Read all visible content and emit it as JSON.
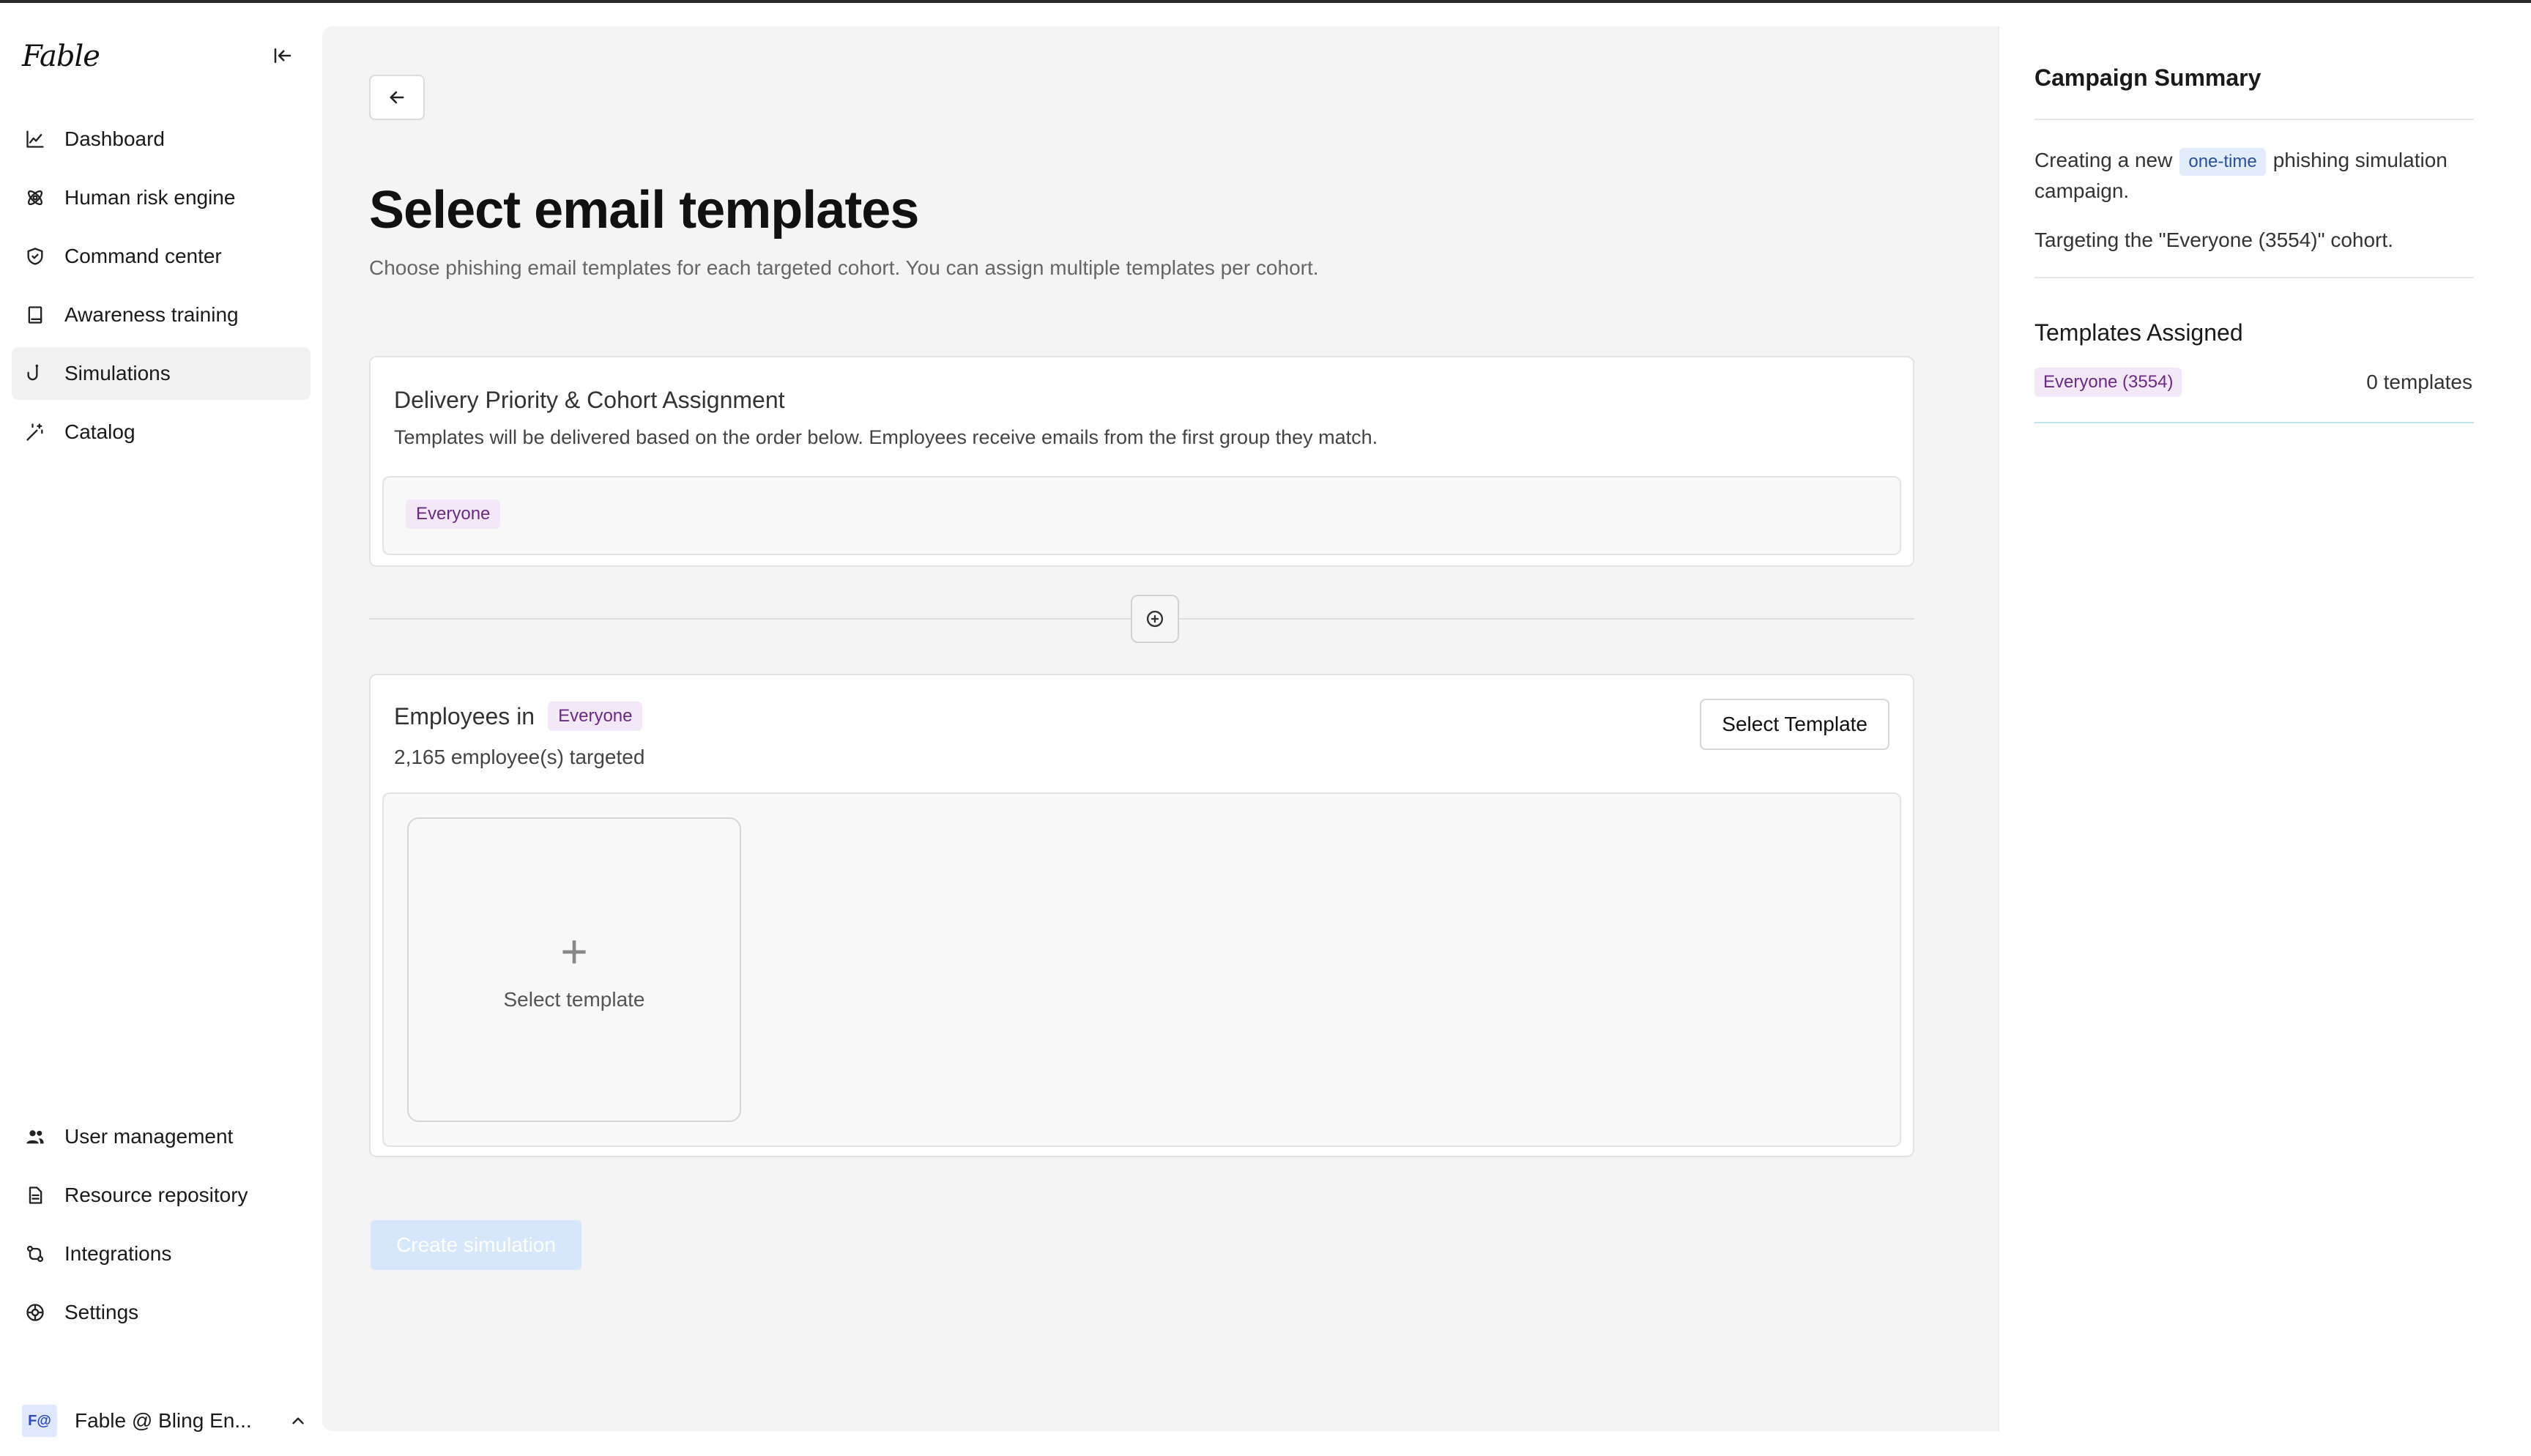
{
  "app": {
    "logo_text": "Fable"
  },
  "sidebar": {
    "top_items": [
      {
        "label": "Dashboard",
        "icon": "chart-line-icon"
      },
      {
        "label": "Human risk engine",
        "icon": "atom-icon"
      },
      {
        "label": "Command center",
        "icon": "shield-check-icon"
      },
      {
        "label": "Awareness training",
        "icon": "book-icon"
      },
      {
        "label": "Simulations",
        "icon": "fish-hook-icon",
        "active": true
      },
      {
        "label": "Catalog",
        "icon": "magic-wand-icon"
      }
    ],
    "bottom_items": [
      {
        "label": "User management",
        "icon": "users-icon"
      },
      {
        "label": "Resource repository",
        "icon": "document-icon"
      },
      {
        "label": "Integrations",
        "icon": "git-compare-icon"
      },
      {
        "label": "Settings",
        "icon": "settings-icon"
      }
    ],
    "account": {
      "avatar": "F@",
      "name": "Fable @ Bling En..."
    }
  },
  "main": {
    "title": "Select email templates",
    "subtitle": "Choose phishing email templates for each targeted cohort. You can assign multiple templates per cohort.",
    "priority_card": {
      "title": "Delivery Priority & Cohort Assignment",
      "description": "Templates will be delivered based on the order below. Employees receive emails from the first group they match.",
      "cohort_tag": "Everyone"
    },
    "cohort_card": {
      "title_prefix": "Employees in",
      "cohort_tag": "Everyone",
      "count_text": "2,165 employee(s) targeted",
      "select_button": "Select Template",
      "slot_label": "Select template"
    },
    "create_button": "Create simulation"
  },
  "summary": {
    "title": "Campaign Summary",
    "line1_prefix": "Creating a new",
    "line1_pill": "one-time",
    "line1_suffix": "phishing simulation campaign.",
    "line2": "Targeting the \"Everyone (3554)\" cohort.",
    "templates_title": "Templates Assigned",
    "templates_tag": "Everyone (3554)",
    "templates_count": "0 templates"
  },
  "colors": {
    "accent_disabled": "#d6e6fb",
    "tag_bg": "#f3e8f7",
    "tag_text": "#6a2a86",
    "pill_bg": "#e3ecfb",
    "pill_text": "#2a4f9a"
  }
}
